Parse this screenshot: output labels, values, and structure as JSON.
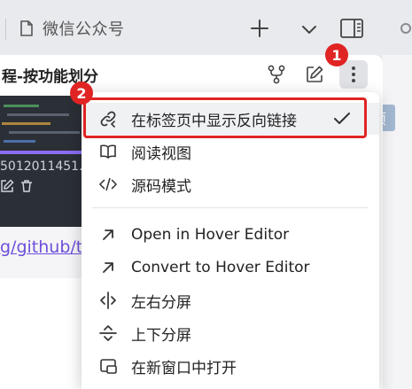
{
  "tabbar": {
    "tab_title": "微信公众号",
    "right_badge_text": "项"
  },
  "pane": {
    "title": "程-按功能划分",
    "card_caption": "5012011451.",
    "link_text": "g/github/t"
  },
  "annotations": {
    "badge_1": "1",
    "badge_2": "2",
    "highlight_color": "#e02424"
  },
  "menu": {
    "items": [
      {
        "label": "在标签页中显示反向链接",
        "icon": "backlink-icon",
        "checked": true
      },
      {
        "label": "阅读视图",
        "icon": "book-open-icon"
      },
      {
        "label": "源码模式",
        "icon": "code-icon"
      },
      {
        "label": "Open in Hover Editor",
        "icon": "arrow-up-right-icon"
      },
      {
        "label": "Convert to Hover Editor",
        "icon": "arrow-up-right-icon"
      },
      {
        "label": "左右分屏",
        "icon": "split-vertical-icon"
      },
      {
        "label": "上下分屏",
        "icon": "split-horizontal-icon"
      },
      {
        "label": "在新窗口中打开",
        "icon": "open-window-icon"
      }
    ]
  },
  "colors": {
    "accent": "#6f4ed9",
    "badge": "#e02424"
  }
}
